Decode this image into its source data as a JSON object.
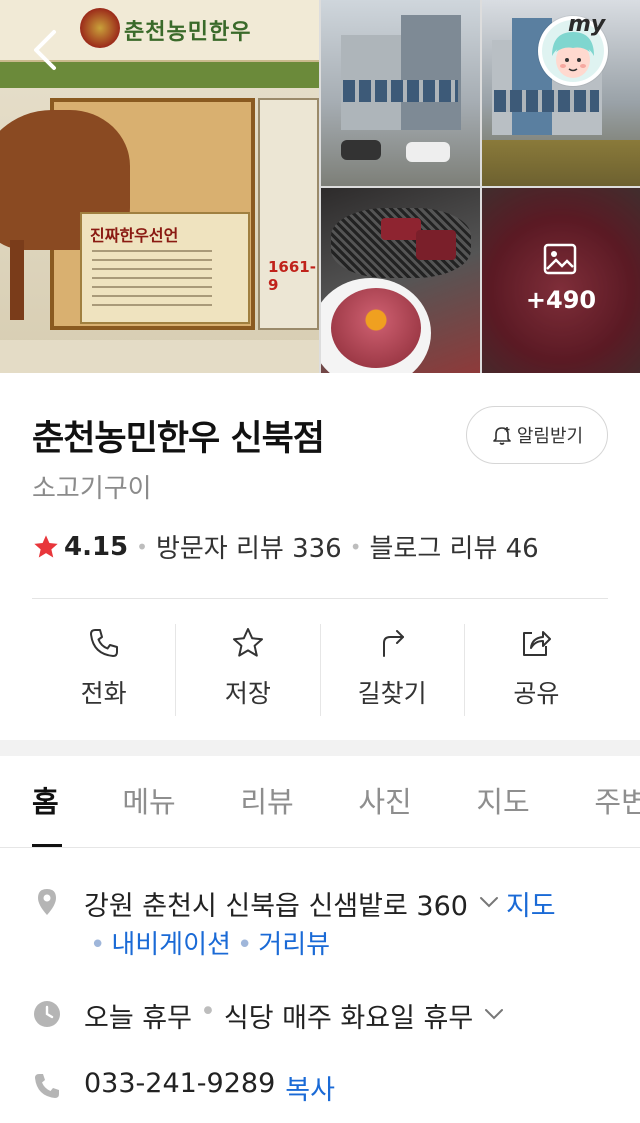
{
  "gallery": {
    "photo_count_more": "+490",
    "sign_logo_text": "춘천농민한우",
    "sign_card_title": "진짜한우선언",
    "sign_phone_partial": "1661-9"
  },
  "top_bar": {
    "back_icon": "chevron-left-icon",
    "my_label": "my"
  },
  "place": {
    "name": "춘천농민한우 신북점",
    "category": "소고기구이",
    "alert_button": "알림받기",
    "rating": "4.15",
    "visitor_reviews": "방문자 리뷰 336",
    "blog_reviews": "블로그 리뷰 46",
    "star_color": "#e8363b"
  },
  "actions": [
    {
      "label": "전화",
      "icon": "phone-icon"
    },
    {
      "label": "저장",
      "icon": "star-outline-icon"
    },
    {
      "label": "길찾기",
      "icon": "directions-icon"
    },
    {
      "label": "공유",
      "icon": "share-icon"
    }
  ],
  "tabs": [
    {
      "label": "홈",
      "active": true
    },
    {
      "label": "메뉴"
    },
    {
      "label": "리뷰"
    },
    {
      "label": "사진"
    },
    {
      "label": "지도"
    },
    {
      "label": "주변"
    }
  ],
  "details": {
    "address": "강원 춘천시 신북읍 신샘밭로 360",
    "map_link": "지도",
    "navigation_link": "내비게이션",
    "street_view_link": "거리뷰",
    "hours_status": "오늘 휴무",
    "hours_note": "식당 매주 화요일 휴무",
    "phone": "033-241-9289",
    "copy_link": "복사"
  },
  "colors": {
    "link_blue": "#1a6ad6",
    "star_red": "#e8363b",
    "muted_gray": "#8b8b8b"
  }
}
